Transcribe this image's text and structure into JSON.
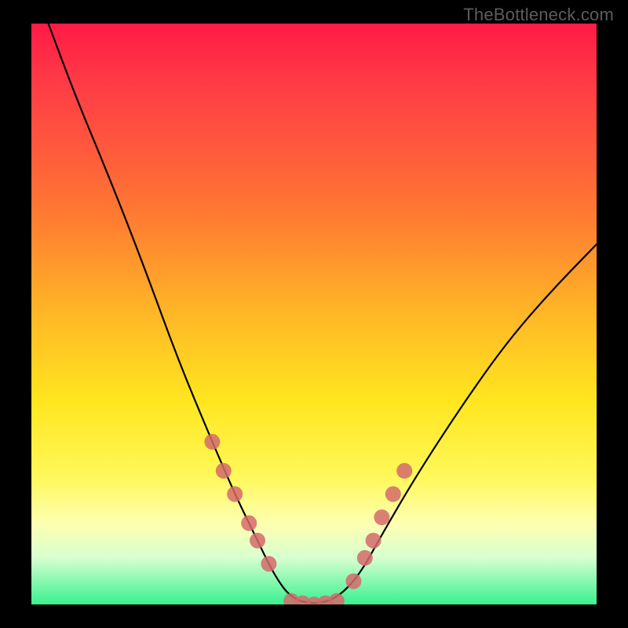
{
  "watermark": "TheBottleneck.com",
  "chart_data": {
    "type": "line",
    "title": "",
    "xlabel": "",
    "ylabel": "",
    "xlim": [
      0,
      100
    ],
    "ylim": [
      0,
      100
    ],
    "grid": false,
    "legend": false,
    "series": [
      {
        "name": "bottleneck-curve",
        "color": "#000000",
        "x": [
          3,
          8,
          14,
          20,
          26,
          32,
          36,
          40,
          43,
          46,
          50,
          54,
          58,
          62,
          68,
          76,
          84,
          92,
          100
        ],
        "y": [
          100,
          87,
          73,
          58,
          42,
          28,
          19,
          11,
          5,
          1,
          0,
          1,
          5,
          12,
          22,
          34,
          45,
          54,
          62
        ]
      }
    ],
    "markers": {
      "name": "highlight-dots",
      "color": "#d46a6a",
      "points": [
        {
          "x": 32,
          "y": 28
        },
        {
          "x": 34,
          "y": 23
        },
        {
          "x": 36,
          "y": 19
        },
        {
          "x": 38.5,
          "y": 14
        },
        {
          "x": 40,
          "y": 11
        },
        {
          "x": 42,
          "y": 7
        },
        {
          "x": 46,
          "y": 0.6
        },
        {
          "x": 48,
          "y": 0.2
        },
        {
          "x": 50,
          "y": 0
        },
        {
          "x": 52,
          "y": 0.2
        },
        {
          "x": 54,
          "y": 0.6
        },
        {
          "x": 57,
          "y": 4
        },
        {
          "x": 59,
          "y": 8
        },
        {
          "x": 60.5,
          "y": 11
        },
        {
          "x": 62,
          "y": 15
        },
        {
          "x": 64,
          "y": 19
        },
        {
          "x": 66,
          "y": 23
        }
      ]
    },
    "background_gradient": {
      "top": "#ff1a46",
      "mid": "#ffe61f",
      "bottom": "#39f18e"
    }
  }
}
